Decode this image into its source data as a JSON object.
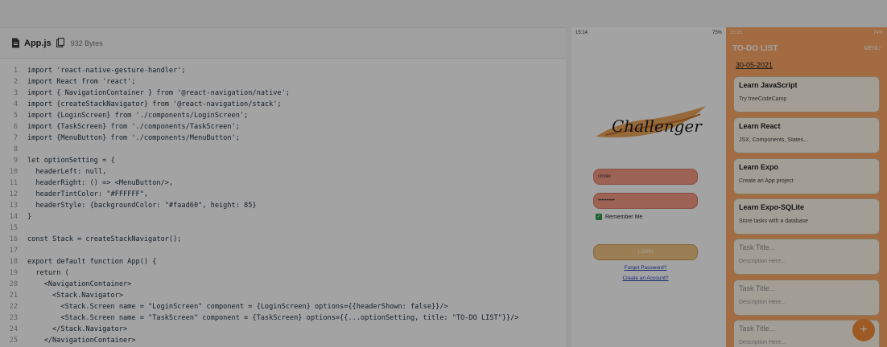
{
  "editor": {
    "file_name": "App.js",
    "file_size": "932 Bytes",
    "lines": [
      {
        "n": "1",
        "text": "import 'react-native-gesture-handler';"
      },
      {
        "n": "2",
        "text": "import React from 'react';"
      },
      {
        "n": "3",
        "text": "import { NavigationContainer } from '@react-navigation/native';"
      },
      {
        "n": "4",
        "text": "import {createStackNavigator} from '@react-navigation/stack';"
      },
      {
        "n": "5",
        "text": "import {LoginScreen} from './components/LoginScreen';"
      },
      {
        "n": "6",
        "text": "import {TaskScreen} from './components/TaskScreen';"
      },
      {
        "n": "7",
        "text": "import {MenuButton} from './components/MenuButton';"
      },
      {
        "n": "8",
        "text": ""
      },
      {
        "n": "9",
        "text": "let optionSetting = {"
      },
      {
        "n": "10",
        "text": "  headerLeft: null,"
      },
      {
        "n": "11",
        "text": "  headerRight: () => <MenuButton/>,"
      },
      {
        "n": "12",
        "text": "  headerTintColor: \"#FFFFFF\","
      },
      {
        "n": "13",
        "text": "  headerStyle: {backgroundColor: \"#faad60\", height: 85}"
      },
      {
        "n": "14",
        "text": "}"
      },
      {
        "n": "15",
        "text": ""
      },
      {
        "n": "16",
        "text": "const Stack = createStackNavigator();"
      },
      {
        "n": "17",
        "text": ""
      },
      {
        "n": "18",
        "text": "export default function App() {"
      },
      {
        "n": "19",
        "text": "  return ("
      },
      {
        "n": "20",
        "text": "    <NavigationContainer>"
      },
      {
        "n": "21",
        "text": "      <Stack.Navigator>"
      },
      {
        "n": "22",
        "text": "        <Stack.Screen name = \"LoginScreen\" component = {LoginScreen} options={{headerShown: false}}/>"
      },
      {
        "n": "23",
        "text": "        <Stack.Screen name = \"TaskScreen\" component = {TaskScreen} options={{...optionSetting, title: \"TO-DO LIST\"}}/>"
      },
      {
        "n": "24",
        "text": "      </Stack.Navigator>"
      },
      {
        "n": "25",
        "text": "    </NavigationContainer>"
      }
    ]
  },
  "login_phone": {
    "status_time": "15:14",
    "status_right": "75%",
    "logo_text": "Challenger",
    "username_value": "cinnie",
    "password_value": "••••••••••",
    "remember_label": "Remember Me",
    "login_label": "LOGIN",
    "forgot_link": "Forgot Password?",
    "create_link": "Create an Account?"
  },
  "todo_phone": {
    "status_time": "15:15",
    "status_right": "74%",
    "title": "TO-DO LIST",
    "menu_label": "MENU",
    "date": "30-05-2021",
    "tasks": [
      {
        "title": "Learn JavaScript",
        "desc": "Try freeCodeCamp"
      },
      {
        "title": "Learn React",
        "desc": "JSX, Components, States..."
      },
      {
        "title": "Learn Expo",
        "desc": "Create an App project"
      },
      {
        "title": "Learn Expo-SQLite",
        "desc": "Store tasks with a database"
      },
      {
        "title": "Task Title...",
        "desc": "Description Here..."
      },
      {
        "title": "Task Title...",
        "desc": "Description Here..."
      },
      {
        "title": "Task Title...",
        "desc": "Description Here..."
      }
    ],
    "fab_label": "+"
  },
  "colors": {
    "accent_orange": "#ffa867",
    "fab": "#f68e3a",
    "input_fill": "#f59b86",
    "login_button": "#f3c583",
    "link_blue": "#1f3fb2"
  }
}
